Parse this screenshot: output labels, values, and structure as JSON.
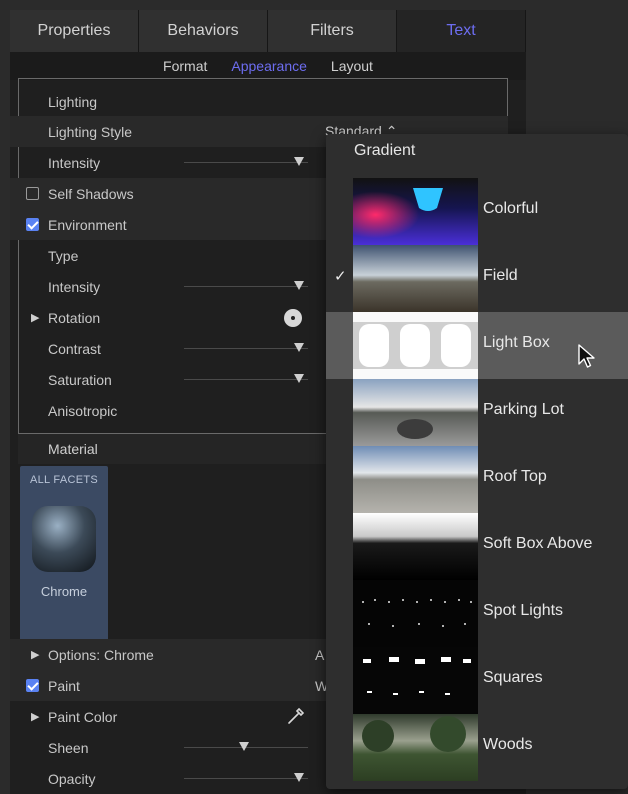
{
  "tabs": [
    {
      "label": "Properties"
    },
    {
      "label": "Behaviors"
    },
    {
      "label": "Filters"
    },
    {
      "label": "Text",
      "active": true
    }
  ],
  "subtabs": [
    {
      "label": "Format"
    },
    {
      "label": "Appearance",
      "active": true
    },
    {
      "label": "Layout"
    }
  ],
  "lighting": {
    "header": "Lighting",
    "style_label": "Lighting Style",
    "style_value": "Standard",
    "intensity_label": "Intensity",
    "intensity_level": 0.95,
    "self_shadows_label": "Self Shadows",
    "self_shadows_checked": false,
    "environment_label": "Environment",
    "environment_checked": true,
    "type_label": "Type",
    "env_intensity_label": "Intensity",
    "env_intensity_level": 0.95,
    "rotation_label": "Rotation",
    "contrast_label": "Contrast",
    "contrast_level": 0.95,
    "saturation_label": "Saturation",
    "saturation_level": 0.95,
    "anisotropic_label": "Anisotropic"
  },
  "material": {
    "header": "Material",
    "facet_title": "ALL FACETS",
    "facet_label": "Chrome"
  },
  "options": {
    "options_label": "Options: Chrome",
    "options_value": "A",
    "paint_label": "Paint",
    "paint_checked": true,
    "paint_value": "W",
    "paint_color_label": "Paint Color",
    "sheen_label": "Sheen",
    "sheen_level": 0.55,
    "opacity_label": "Opacity",
    "opacity_level": 0.95
  },
  "dropdown": {
    "title": "Gradient",
    "items": [
      {
        "label": "Colorful",
        "checked": false
      },
      {
        "label": "Field",
        "checked": true
      },
      {
        "label": "Light Box",
        "checked": false,
        "highlighted": true
      },
      {
        "label": "Parking Lot",
        "checked": false
      },
      {
        "label": "Roof Top",
        "checked": false
      },
      {
        "label": "Soft Box Above",
        "checked": false
      },
      {
        "label": "Spot Lights",
        "checked": false
      },
      {
        "label": "Squares",
        "checked": false
      },
      {
        "label": "Woods",
        "checked": false
      }
    ],
    "check_glyph": "✓"
  },
  "colors": {
    "accent": "#6d6df0",
    "checkbox": "#5a82f2",
    "facet_bg": "#3b4a63"
  }
}
